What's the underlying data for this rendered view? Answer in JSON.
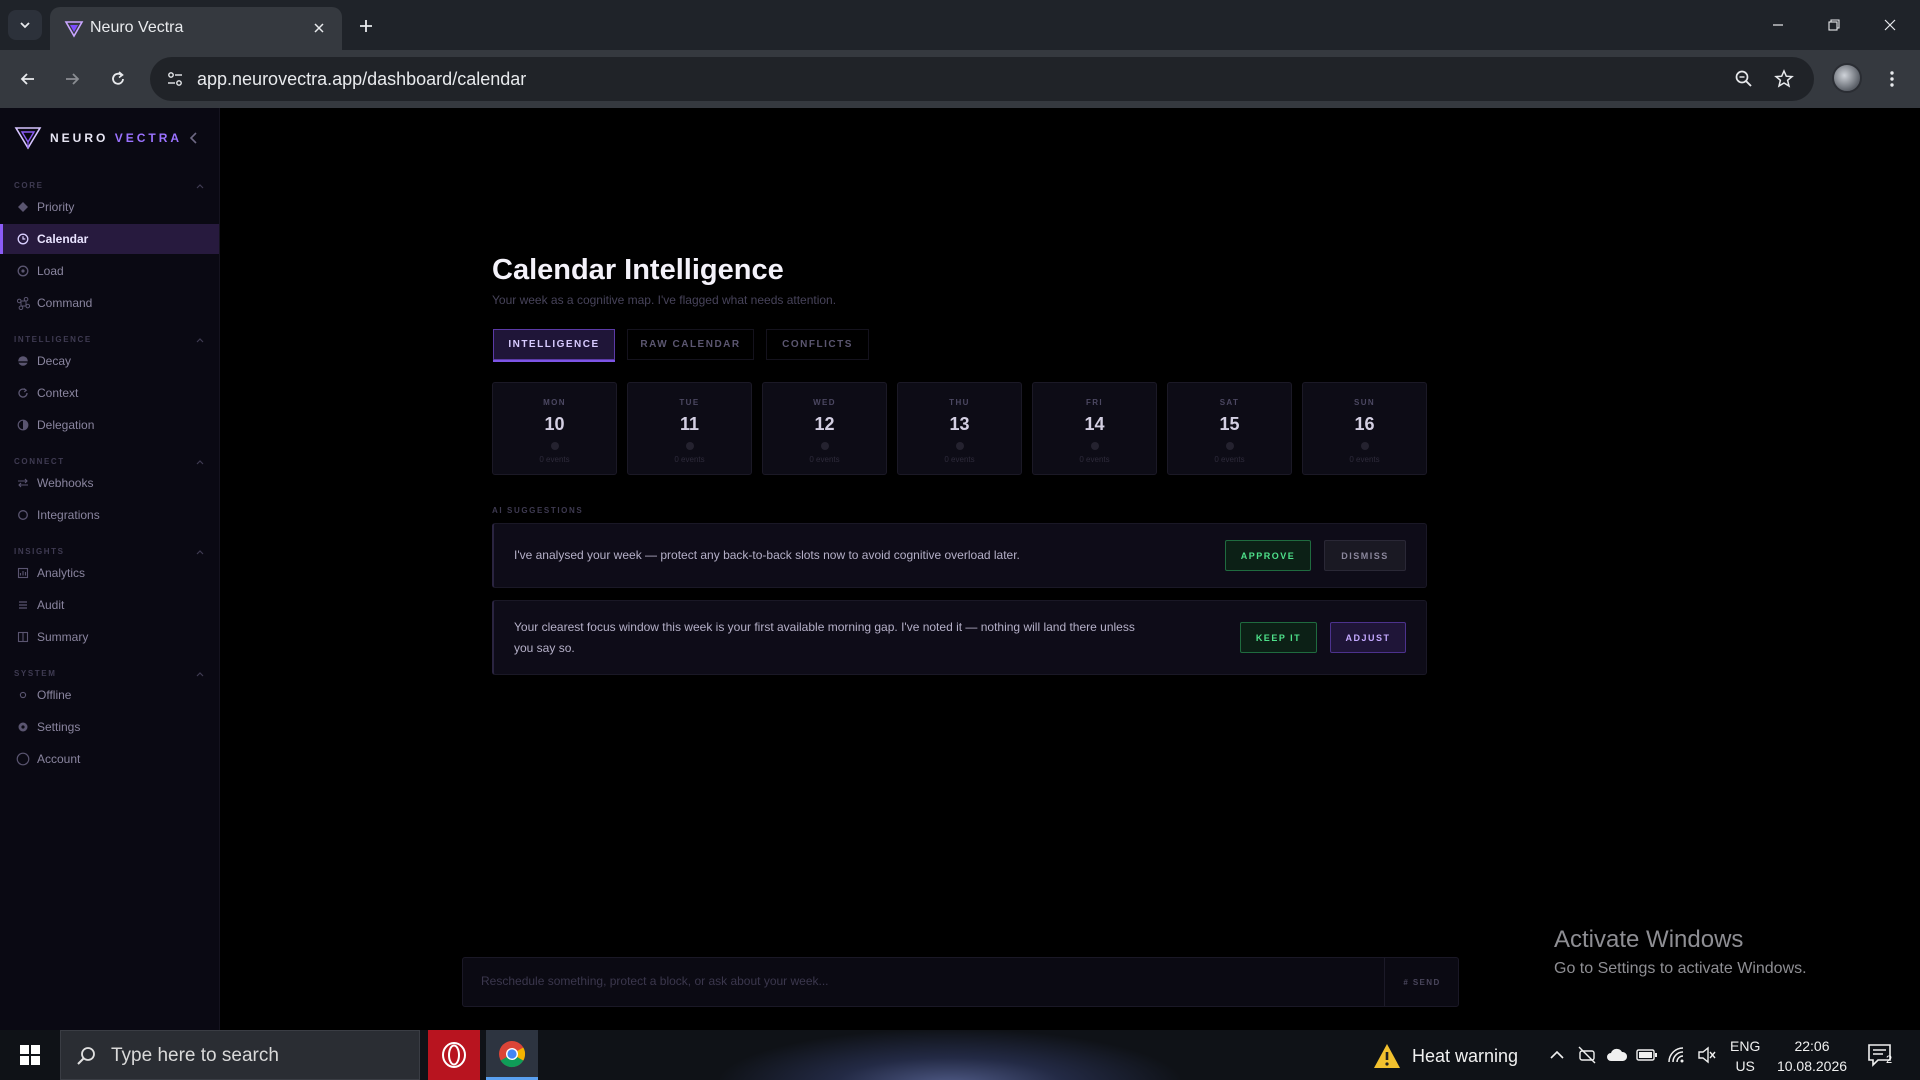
{
  "browser": {
    "tab_title": "Neuro Vectra",
    "url": "app.neurovectra.app/dashboard/calendar"
  },
  "brand": {
    "name_part1": "NEURO",
    "name_part2": "VECTRA"
  },
  "sidebar": {
    "sections": [
      {
        "label": "CORE",
        "items": [
          {
            "label": "Priority",
            "icon": "diamond-icon"
          },
          {
            "label": "Calendar",
            "icon": "clock-icon",
            "active": true
          },
          {
            "label": "Load",
            "icon": "gauge-icon"
          },
          {
            "label": "Command",
            "icon": "command-icon"
          }
        ]
      },
      {
        "label": "INTELLIGENCE",
        "items": [
          {
            "label": "Decay",
            "icon": "half-circle-icon"
          },
          {
            "label": "Context",
            "icon": "refresh-icon"
          },
          {
            "label": "Delegation",
            "icon": "contrast-icon"
          }
        ]
      },
      {
        "label": "CONNECT",
        "items": [
          {
            "label": "Webhooks",
            "icon": "arrows-icon"
          },
          {
            "label": "Integrations",
            "icon": "ring-icon"
          }
        ]
      },
      {
        "label": "INSIGHTS",
        "items": [
          {
            "label": "Analytics",
            "icon": "chart-icon"
          },
          {
            "label": "Audit",
            "icon": "list-icon"
          },
          {
            "label": "Summary",
            "icon": "book-icon"
          }
        ]
      },
      {
        "label": "SYSTEM",
        "items": [
          {
            "label": "Offline",
            "icon": "dot-icon"
          },
          {
            "label": "Settings",
            "icon": "gear-icon"
          },
          {
            "label": "Account",
            "icon": "user-circle-icon"
          }
        ]
      }
    ]
  },
  "main": {
    "title": "Calendar Intelligence",
    "subtitle": "Your week as a cognitive map. I've flagged what needs attention.",
    "tabs": [
      {
        "label": "INTELLIGENCE",
        "active": true
      },
      {
        "label": "RAW CALENDAR"
      },
      {
        "label": "CONFLICTS"
      }
    ],
    "days": [
      {
        "name": "MON",
        "num": "10",
        "events": "0 events"
      },
      {
        "name": "TUE",
        "num": "11",
        "events": "0 events"
      },
      {
        "name": "WED",
        "num": "12",
        "events": "0 events"
      },
      {
        "name": "THU",
        "num": "13",
        "events": "0 events"
      },
      {
        "name": "FRI",
        "num": "14",
        "events": "0 events"
      },
      {
        "name": "SAT",
        "num": "15",
        "events": "0 events"
      },
      {
        "name": "SUN",
        "num": "16",
        "events": "0 events"
      }
    ],
    "suggestions_label": "AI SUGGESTIONS",
    "suggestions": [
      {
        "text": "I've analysed your week — protect any back-to-back slots now to avoid cognitive overload later.",
        "primary": "APPROVE",
        "secondary": "DISMISS"
      },
      {
        "text_line1": "Your clearest focus window this week is your first available morning gap. I've noted it — nothing will land there unless",
        "text_line2": "you say so.",
        "primary": "KEEP IT",
        "secondary": "ADJUST"
      }
    ],
    "chat": {
      "placeholder": "Reschedule something, protect a block, or ask about your week...",
      "send_label": "# SEND"
    }
  },
  "watermark": {
    "title": "Activate Windows",
    "subtitle": "Go to Settings to activate Windows."
  },
  "taskbar": {
    "search_placeholder": "Type here to search",
    "weather_text": "Heat warning",
    "lang_line1": "ENG",
    "lang_line2": "US",
    "time": "22:06",
    "date": "10.08.2026",
    "notification_count": "2"
  },
  "colors": {
    "accent": "#8b5cf6",
    "active_nav_bg": "#271a3e",
    "approve_green": "#4ee08a",
    "background": "#000000"
  }
}
